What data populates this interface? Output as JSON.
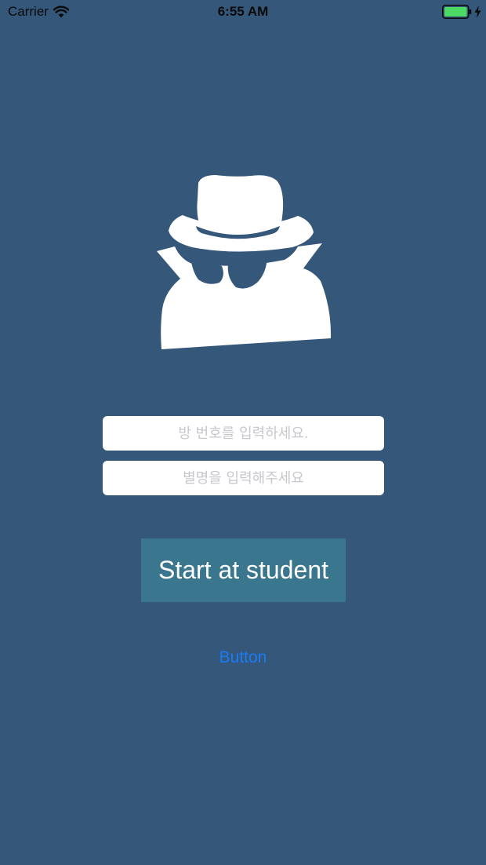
{
  "status_bar": {
    "carrier": "Carrier",
    "time": "6:55 AM",
    "battery_color": "#4cd964"
  },
  "icons": {
    "wifi": "wifi-icon",
    "battery": "battery-icon",
    "charging": "charging-bolt-icon",
    "spy": "incognito-spy-icon"
  },
  "form": {
    "room_placeholder": "방 번호를 입력하세요.",
    "nickname_placeholder": "별명을 입력해주세요"
  },
  "buttons": {
    "start_label": "Start at student",
    "secondary_label": "Button"
  },
  "colors": {
    "background": "#35577a",
    "start_button": "#3a768e",
    "link": "#1a7cf5"
  }
}
